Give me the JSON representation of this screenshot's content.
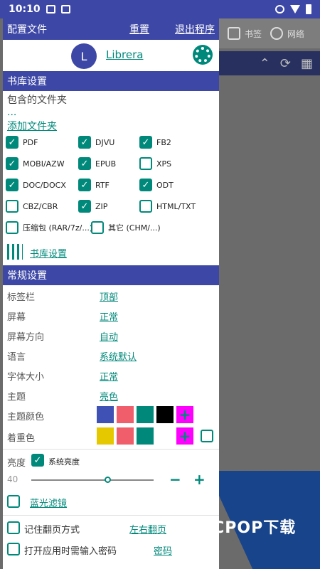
{
  "status": {
    "time": "10:10"
  },
  "background": {
    "tab_bookmark": "书签",
    "tab_network": "网络"
  },
  "header": {
    "title": "配置文件",
    "reset": "重置",
    "exit": "退出程序"
  },
  "profile": {
    "initial": "L",
    "name": "Librera"
  },
  "library": {
    "section": "书库设置",
    "folders_label": "包含的文件夹",
    "folders_value": "...",
    "add_folder": "添加文件夹",
    "settings_link": "书库设置",
    "formats": [
      {
        "label": "PDF",
        "checked": true
      },
      {
        "label": "DJVU",
        "checked": true
      },
      {
        "label": "FB2",
        "checked": true
      },
      {
        "label": "MOBI/AZW",
        "checked": true
      },
      {
        "label": "EPUB",
        "checked": true
      },
      {
        "label": "XPS",
        "checked": false
      },
      {
        "label": "DOC/DOCX",
        "checked": true
      },
      {
        "label": "RTF",
        "checked": true
      },
      {
        "label": "ODT",
        "checked": true
      },
      {
        "label": "CBZ/CBR",
        "checked": false
      },
      {
        "label": "ZIP",
        "checked": true
      },
      {
        "label": "HTML/TXT",
        "checked": false
      },
      {
        "label": "压缩包 (RAR/7z/...)",
        "checked": false
      },
      {
        "label": "其它 (CHM/...)",
        "checked": false
      }
    ]
  },
  "general": {
    "section": "常规设置",
    "tabbar_label": "标签栏",
    "tabbar_value": "顶部",
    "screen_label": "屏幕",
    "screen_value": "正常",
    "orientation_label": "屏幕方向",
    "orientation_value": "自动",
    "language_label": "语言",
    "language_value": "系统默认",
    "fontsize_label": "字体大小",
    "fontsize_value": "正常",
    "theme_label": "主题",
    "theme_value": "亮色",
    "theme_color_label": "主题颜色",
    "theme_colors": [
      "#3f51b5",
      "#ef5e6a",
      "#00897b",
      "#000000",
      "#ff00ff"
    ],
    "accent_label": "着重色",
    "accent_colors": [
      "#e6c800",
      "#ef5e6a",
      "#00897b",
      "#ffffff",
      "#ff00ff"
    ],
    "brightness_label": "亮度",
    "system_brightness": "系统亮度",
    "brightness_value": "40",
    "brightness_level": 0.62,
    "minus": "−",
    "plus": "+",
    "bluelight": "蓝光滤镜",
    "remember_page": "记住翻页方式",
    "page_mode": "左右翻页",
    "password_label": "打开应用时需输入密码",
    "password_link": "密码"
  },
  "watermark": {
    "text": "PCPOP下载"
  }
}
